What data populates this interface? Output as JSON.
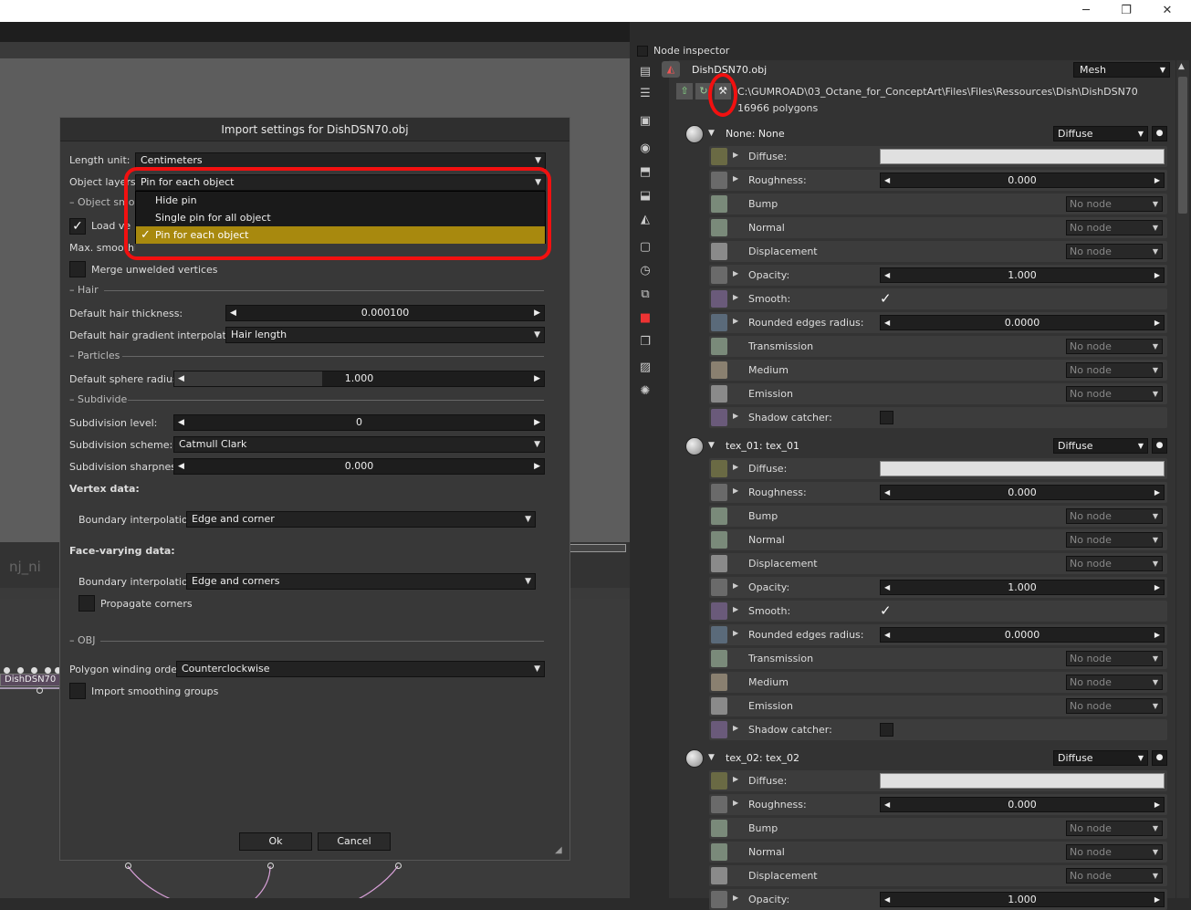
{
  "window": {
    "minimize_glyph": "─",
    "maximize_glyph": "❐",
    "close_glyph": "✕"
  },
  "graph": {
    "node_label": "DishDSN70",
    "ghost_text": "nj_ni"
  },
  "dialog": {
    "title": "Import settings for DishDSN70.obj",
    "length_unit_label": "Length unit:",
    "length_unit_value": "Centimeters",
    "object_layers_label": "Object layers",
    "object_layers_value": "Pin for each object",
    "object_layers_options": [
      "Hide pin",
      "Single pin for all object",
      "Pin for each object"
    ],
    "object_smoothing_section": "– Object smo",
    "load_vertex_label": "Load ve",
    "load_vertex_checked": "✓",
    "max_smoothing_label": "Max. smoothing angle:",
    "merge_unwelded_label": "Merge unwelded vertices",
    "hair_section": "– Hair",
    "hair_thickness_label": "Default hair thickness:",
    "hair_thickness_value": "0.000100",
    "hair_gradient_label": "Default hair gradient interpolation:",
    "hair_gradient_value": "Hair length",
    "particles_section": "– Particles",
    "sphere_radius_label": "Default sphere radius:",
    "sphere_radius_value": "1.000",
    "sphere_radius_fill": 0.4,
    "subdivide_section": "– Subdivide",
    "subdiv_level_label": "Subdivision level:",
    "subdiv_level_value": "0",
    "subdiv_scheme_label": "Subdivision scheme:",
    "subdiv_scheme_value": "Catmull Clark",
    "subdiv_sharpness_label": "Subdivision sharpness:",
    "subdiv_sharpness_value": "0.000",
    "vertex_data_label": "Vertex data:",
    "vertex_boundary_label": "Boundary interpolation:",
    "vertex_boundary_value": "Edge and corner",
    "face_varying_label": "Face-varying data:",
    "face_boundary_label": "Boundary interpolation:",
    "face_boundary_value": "Edge and corners",
    "propagate_corners_label": "Propagate corners",
    "obj_section": "– OBJ",
    "winding_label": "Polygon winding order:",
    "winding_value": "Counterclockwise",
    "import_smoothing_label": "Import smoothing groups",
    "ok_label": "Ok",
    "cancel_label": "Cancel"
  },
  "inspector": {
    "title": "Node inspector",
    "mesh_name": "DishDSN70.obj",
    "mesh_type": "Mesh",
    "path": "C:\\GUMROAD\\03_Octane_for_ConceptArt\\Files\\Files\\Ressources\\Dish\\DishDSN70.obj",
    "polygons": "16966 polygons",
    "materials": [
      {
        "name": "None: None",
        "type": "Diffuse"
      },
      {
        "name": "tex_01: tex_01",
        "type": "Diffuse"
      },
      {
        "name": "tex_02: tex_02",
        "type": "Diffuse"
      }
    ],
    "rows": {
      "diffuse": "Diffuse:",
      "roughness": "Roughness:",
      "roughness_value": "0.000",
      "bump": "Bump",
      "normal": "Normal",
      "displacement": "Displacement",
      "opacity": "Opacity:",
      "opacity_value": "1.000",
      "smooth": "Smooth:",
      "smooth_check": "✓",
      "rounded": "Rounded edges radius:",
      "rounded_value": "0.0000",
      "transmission": "Transmission",
      "medium": "Medium",
      "emission": "Emission",
      "shadow_catcher": "Shadow catcher:",
      "no_node": "No node"
    },
    "tools": [
      "layers-icon",
      "stack-icon",
      "image-icon",
      "camera-icon",
      "geometry-icon",
      "material-icon",
      "texture-icon",
      "frame-icon",
      "clock-icon",
      "transform-icon",
      "cube-icon",
      "layers2-icon",
      "picture-icon",
      "light-icon"
    ]
  },
  "colors": {
    "accent_selection": "#a8890e",
    "highlight_red": "#f21010"
  }
}
